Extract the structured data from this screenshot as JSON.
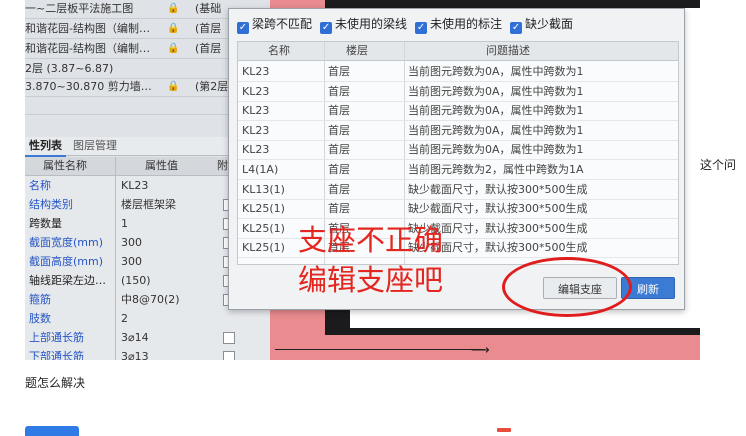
{
  "left_panel": {
    "tree_rows": [
      {
        "name": "一~二层板平法施工图",
        "lock": "🔒",
        "layer": "(基础"
      },
      {
        "name": "和谐花园-结构图（编制…",
        "lock": "🔒",
        "layer": "(首层"
      },
      {
        "name": "和谐花园-结构图（编制…",
        "lock": "🔒",
        "layer": "(首层"
      },
      {
        "name": "2层 (3.87~6.87)",
        "lock": "",
        "layer": ""
      },
      {
        "name": "3.870~30.870 剪力墙…",
        "lock": "🔒",
        "layer": "(第2层"
      },
      {
        "name": "",
        "lock": "",
        "layer": ""
      }
    ],
    "tabs": [
      "性列表",
      "图层管理"
    ],
    "prop_headers": {
      "name": "属性名称",
      "value": "属性值",
      "attach": "附"
    },
    "props": [
      {
        "name": "名称",
        "value": "KL23",
        "blue": true,
        "checkbox": false
      },
      {
        "name": "结构类别",
        "value": "楼层框架梁",
        "blue": true,
        "checkbox": true
      },
      {
        "name": "跨数量",
        "value": "1",
        "blue": false,
        "checkbox": true
      },
      {
        "name": "截面宽度(mm)",
        "value": "300",
        "blue": true,
        "checkbox": true
      },
      {
        "name": "截面高度(mm)",
        "value": "300",
        "blue": true,
        "checkbox": true
      },
      {
        "name": "轴线距梁左边…",
        "value": "(150)",
        "blue": false,
        "checkbox": true
      },
      {
        "name": "箍筋",
        "value": "中8@70(2)",
        "blue": true,
        "checkbox": true
      },
      {
        "name": "肢数",
        "value": "2",
        "blue": true,
        "checkbox": false
      },
      {
        "name": "上部通长筋",
        "value": "3⌀14",
        "blue": true,
        "checkbox": true
      },
      {
        "name": "下部通长筋",
        "value": "3⌀13",
        "blue": true,
        "checkbox": true
      }
    ]
  },
  "dialog": {
    "filters": [
      {
        "label": "梁跨不匹配",
        "checked": true
      },
      {
        "label": "未使用的梁线",
        "checked": true
      },
      {
        "label": "未使用的标注",
        "checked": true
      },
      {
        "label": "缺少截面",
        "checked": true
      }
    ],
    "columns": [
      "名称",
      "楼层",
      "问题描述"
    ],
    "rows": [
      {
        "name": "KL23",
        "floor": "首层",
        "desc": "当前图元跨数为0A，属性中跨数为1"
      },
      {
        "name": "KL23",
        "floor": "首层",
        "desc": "当前图元跨数为0A，属性中跨数为1"
      },
      {
        "name": "KL23",
        "floor": "首层",
        "desc": "当前图元跨数为0A，属性中跨数为1"
      },
      {
        "name": "KL23",
        "floor": "首层",
        "desc": "当前图元跨数为0A，属性中跨数为1"
      },
      {
        "name": "KL23",
        "floor": "首层",
        "desc": "当前图元跨数为0A，属性中跨数为1"
      },
      {
        "name": "L4(1A)",
        "floor": "首层",
        "desc": "当前图元跨数为2，属性中跨数为1A"
      },
      {
        "name": "KL13(1)",
        "floor": "首层",
        "desc": "缺少截面尺寸，默认按300*500生成"
      },
      {
        "name": "KL25(1)",
        "floor": "首层",
        "desc": "缺少截面尺寸，默认按300*500生成"
      },
      {
        "name": "KL25(1)",
        "floor": "首层",
        "desc": "缺少截面尺寸，默认按300*500生成"
      },
      {
        "name": "KL25(1)",
        "floor": "首层",
        "desc": "缺少截面尺寸，默认按300*500生成"
      }
    ],
    "edit_button": "编辑支座",
    "refresh_button": "刷新"
  },
  "annotation": {
    "line1": "支座不正确",
    "line2": "编辑支座吧"
  },
  "page": {
    "side_text": "这个问",
    "below_text": "题怎么解决"
  },
  "colors": {
    "annotation_red": "#e3261f",
    "checkbox_blue": "#2f6fd6",
    "cad_red": "#e98b8f"
  }
}
